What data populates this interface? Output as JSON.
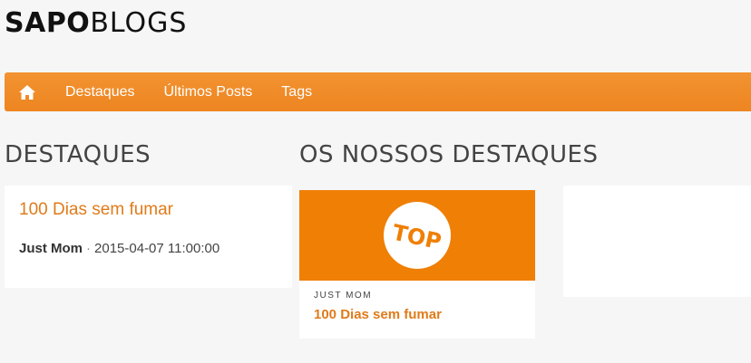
{
  "logo": {
    "bold": "SAPO",
    "light": "BLOGS"
  },
  "nav": {
    "home_icon": "home-icon",
    "items": [
      "Destaques",
      "Últimos Posts",
      "Tags"
    ]
  },
  "left_section": {
    "title": "DESTAQUES",
    "post": {
      "title": "100 Dias sem fumar",
      "author": "Just Mom",
      "separator": "·",
      "date": "2015-04-07 11:00:00"
    }
  },
  "right_section": {
    "title": "OS NOSSOS DESTAQUES",
    "feature": {
      "badge": "TOP",
      "kicker": "JUST MOM",
      "title": "100 Dias sem fumar"
    }
  },
  "colors": {
    "accent": "#ef7f05",
    "link": "#e07b1a",
    "nav_bg": "#f0892a"
  }
}
